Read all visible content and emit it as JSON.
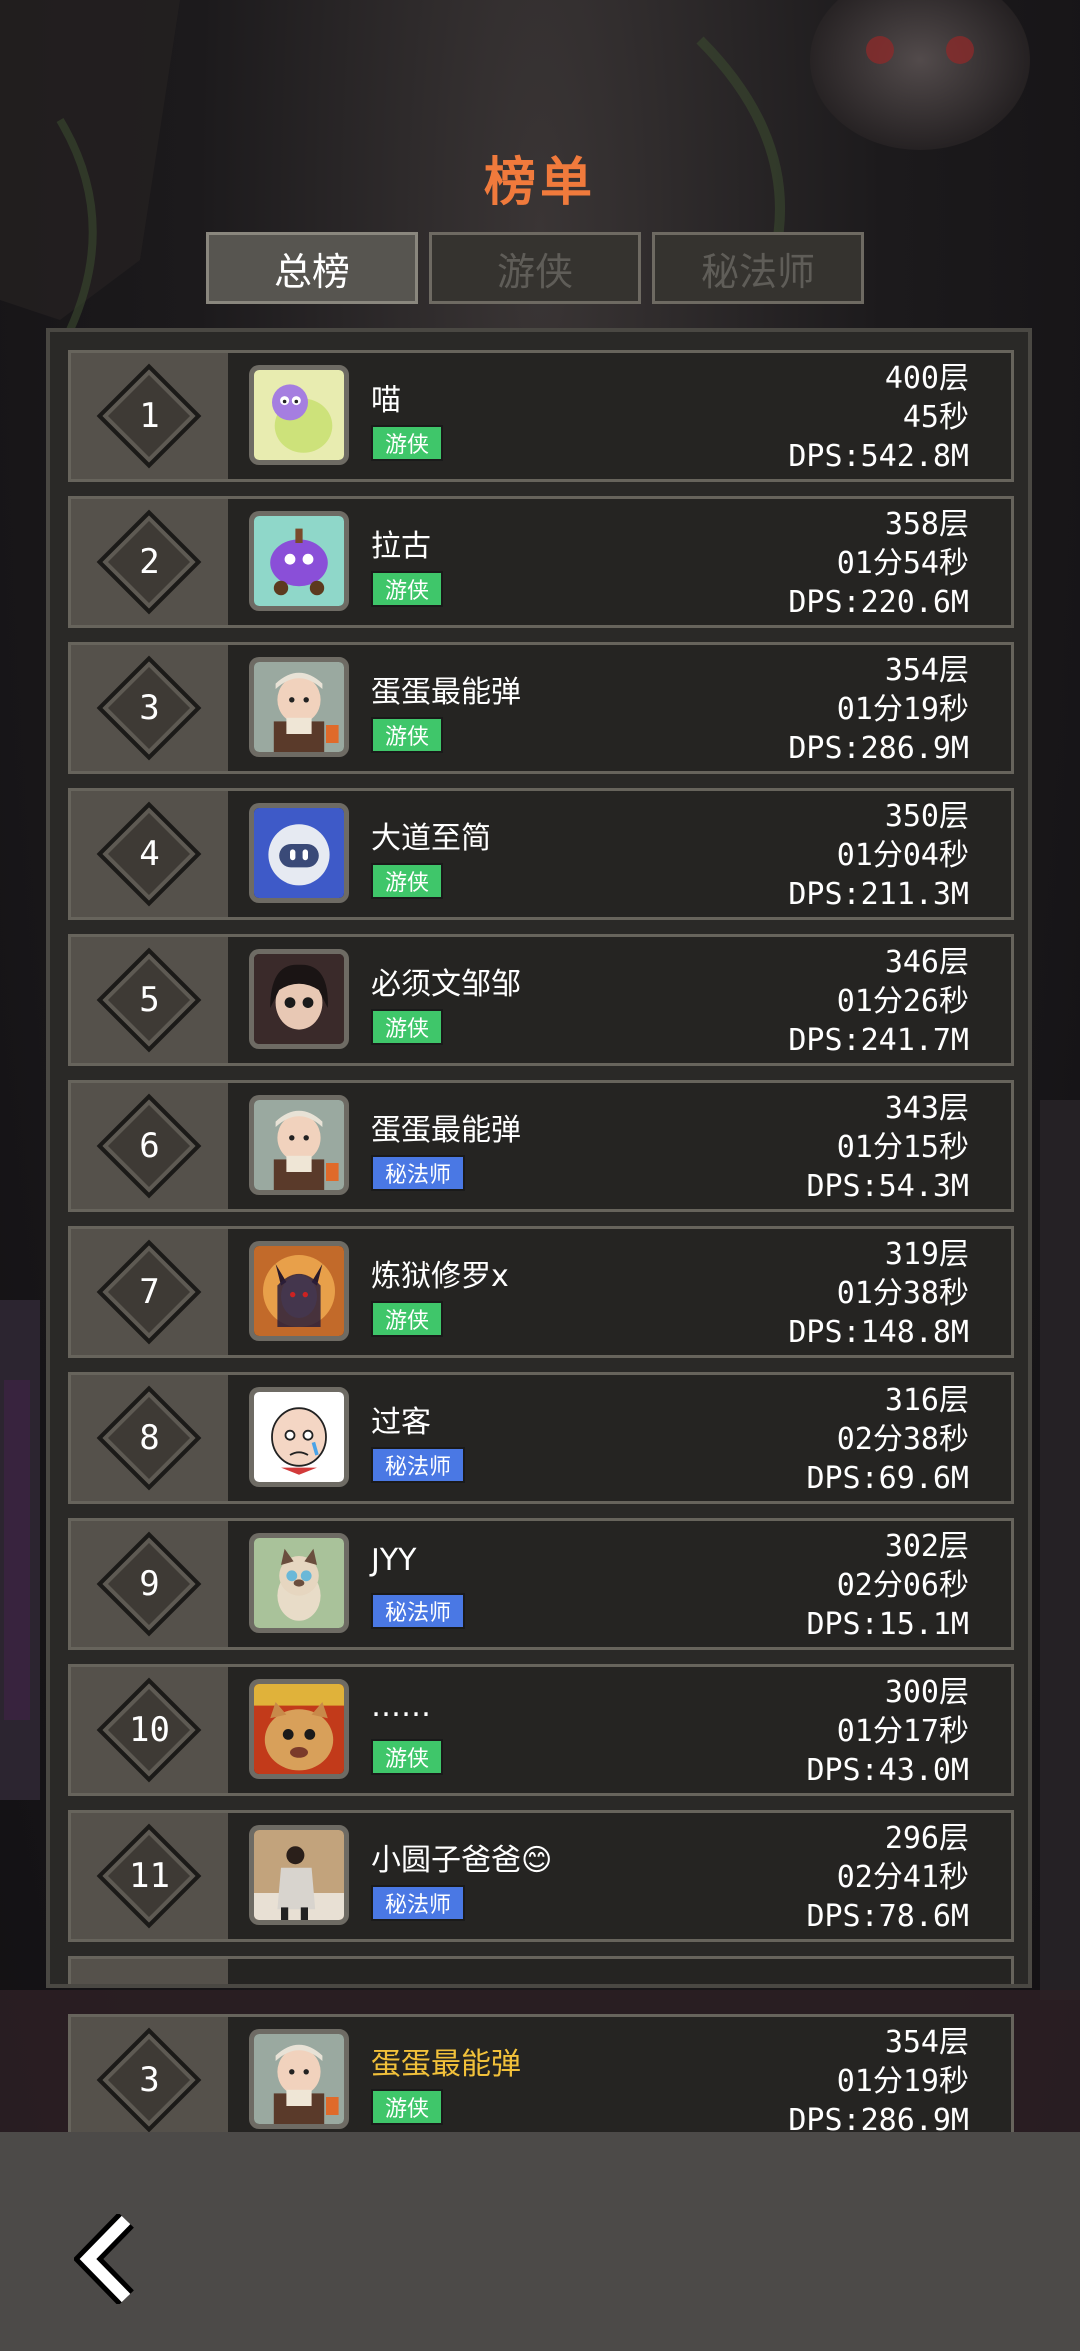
{
  "title": "榜单",
  "tabs": [
    {
      "label": "总榜",
      "active": true
    },
    {
      "label": "游侠",
      "active": false
    },
    {
      "label": "秘法师",
      "active": false
    }
  ],
  "classes": {
    "ranger": "游侠",
    "mage": "秘法师"
  },
  "colors": {
    "title": "#f07a3c",
    "ranger_badge": "#3fc66a",
    "mage_badge": "#4a78e4",
    "self_name": "#f2c13a"
  },
  "entries": [
    {
      "rank": "1",
      "name": "喵",
      "class_label": "游侠",
      "class": "ranger",
      "floor": "400层",
      "time": "45秒",
      "dps": "DPS:542.8M",
      "avatar": "purple-cartoon-creature"
    },
    {
      "rank": "2",
      "name": "拉古",
      "class_label": "游侠",
      "class": "ranger",
      "floor": "358层",
      "time": "01分54秒",
      "dps": "DPS:220.6M",
      "avatar": "purple-slime-cart"
    },
    {
      "rank": "3",
      "name": "蛋蛋最能弹",
      "class_label": "游侠",
      "class": "ranger",
      "floor": "354层",
      "time": "01分19秒",
      "dps": "DPS:286.9M",
      "avatar": "baby-photo"
    },
    {
      "rank": "4",
      "name": "大道至简",
      "class_label": "游侠",
      "class": "ranger",
      "floor": "350层",
      "time": "01分04秒",
      "dps": "DPS:211.3M",
      "avatar": "robot-face"
    },
    {
      "rank": "5",
      "name": "必须文邹邹",
      "class_label": "游侠",
      "class": "ranger",
      "floor": "346层",
      "time": "01分26秒",
      "dps": "DPS:241.7M",
      "avatar": "dark-hair-doll"
    },
    {
      "rank": "6",
      "name": "蛋蛋最能弹",
      "class_label": "秘法师",
      "class": "mage",
      "floor": "343层",
      "time": "01分15秒",
      "dps": "DPS:54.3M",
      "avatar": "baby-photo"
    },
    {
      "rank": "7",
      "name": "炼狱修罗x",
      "class_label": "游侠",
      "class": "ranger",
      "floor": "319层",
      "time": "01分38秒",
      "dps": "DPS:148.8M",
      "avatar": "demon-character"
    },
    {
      "rank": "8",
      "name": "过客",
      "class_label": "秘法师",
      "class": "mage",
      "floor": "316层",
      "time": "02分38秒",
      "dps": "DPS:69.6M",
      "avatar": "bald-cartoon-man"
    },
    {
      "rank": "9",
      "name": "JYY",
      "class_label": "秘法师",
      "class": "mage",
      "floor": "302层",
      "time": "02分06秒",
      "dps": "DPS:15.1M",
      "avatar": "siamese-cat"
    },
    {
      "rank": "10",
      "name": "……",
      "class_label": "游侠",
      "class": "ranger",
      "floor": "300层",
      "time": "01分17秒",
      "dps": "DPS:43.0M",
      "avatar": "orange-cat"
    },
    {
      "rank": "11",
      "name": "小圆子爸爸😊",
      "class_label": "秘法师",
      "class": "mage",
      "floor": "296层",
      "time": "02分41秒",
      "dps": "DPS:78.6M",
      "avatar": "person-photo"
    }
  ],
  "self_entry": {
    "rank": "3",
    "name": "蛋蛋最能弹",
    "class_label": "游侠",
    "class": "ranger",
    "floor": "354层",
    "time": "01分19秒",
    "dps": "DPS:286.9M",
    "avatar": "baby-photo"
  },
  "back_icon": "back-arrow-icon"
}
